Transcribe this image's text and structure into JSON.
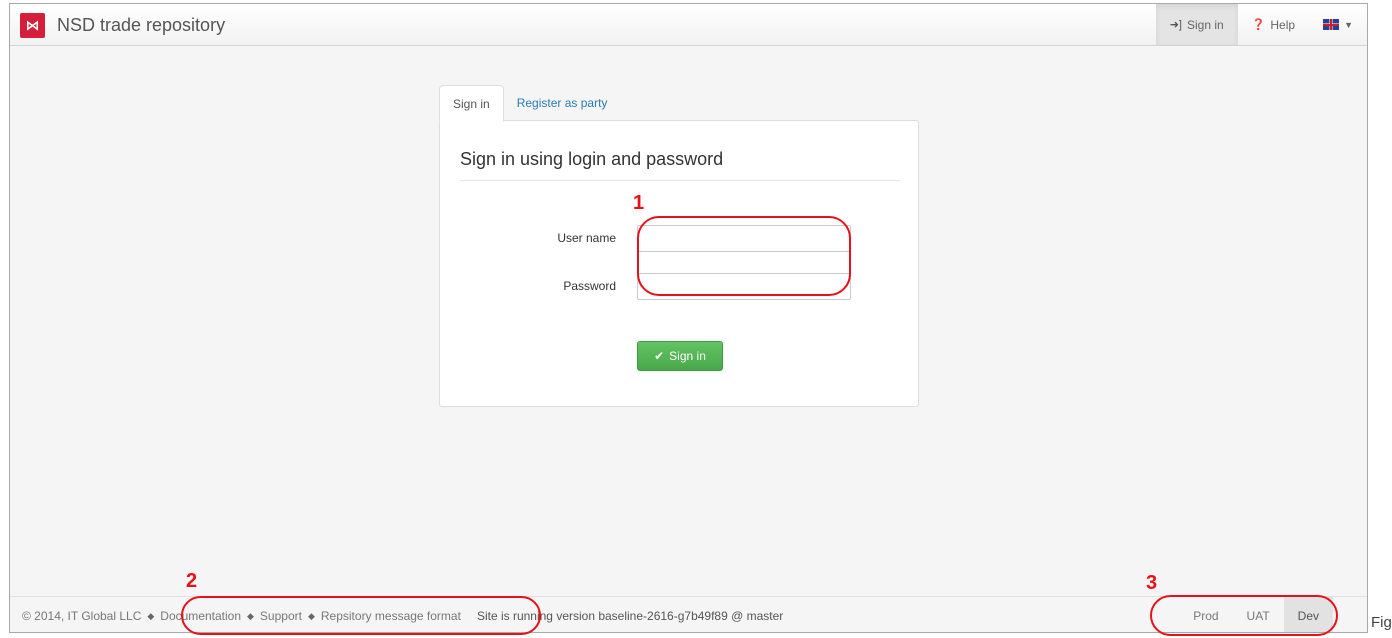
{
  "navbar": {
    "logo_glyph": "⋈",
    "title": "NSD trade repository",
    "items": [
      {
        "label": "Sign in",
        "icon": "sign-in-icon",
        "active": true
      },
      {
        "label": "Help",
        "icon": "question-circle-icon",
        "active": false
      }
    ],
    "language_icon": "uk-flag-icon"
  },
  "tabs": [
    {
      "label": "Sign in",
      "active": true
    },
    {
      "label": "Register as party",
      "active": false
    }
  ],
  "form": {
    "title": "Sign in using login and password",
    "username_label": "User name",
    "username_value": "",
    "password_label": "Password",
    "password_value": "",
    "submit_label": "Sign in"
  },
  "footer": {
    "copyright": "© 2014, IT Global LLC",
    "links": [
      "Documentation",
      "Support",
      "Repsitory message format"
    ],
    "version": "Site is running version baseline-2616-g7b49f89 @ master",
    "environments": [
      {
        "label": "Prod",
        "active": false
      },
      {
        "label": "UAT",
        "active": false
      },
      {
        "label": "Dev",
        "active": true
      }
    ]
  },
  "annotations": [
    "1",
    "2",
    "3"
  ],
  "caption_fragment": "Fig",
  "colors": {
    "brand_red": "#d41e3a",
    "success_green": "#5cb85c",
    "link_blue": "#2a7ab8",
    "annotation_red": "#e8101a"
  }
}
